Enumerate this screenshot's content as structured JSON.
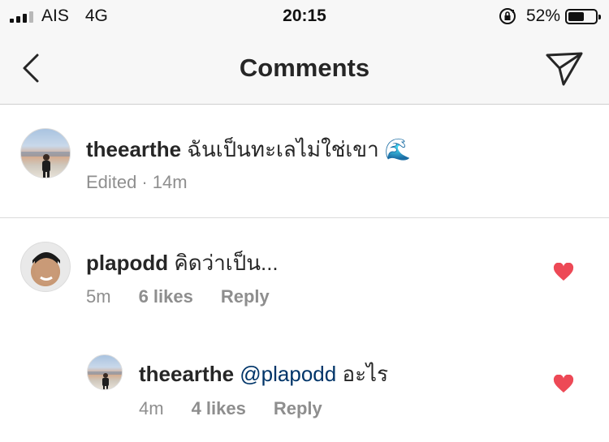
{
  "status_bar": {
    "carrier": "AIS",
    "network": "4G",
    "time": "20:15",
    "battery_percent": "52%",
    "battery_level": 0.52
  },
  "header": {
    "title": "Comments",
    "back_icon": "chevron-left-icon",
    "send_icon": "paper-plane-icon"
  },
  "caption": {
    "username": "theearthe",
    "text": "ฉันเป็นทะเลไม่ใช่เขา 🌊",
    "edited_label": "Edited",
    "separator": "·",
    "time": "14m"
  },
  "comments": [
    {
      "username": "plapodd",
      "text": "คิดว่าเป็น...",
      "time": "5m",
      "likes": "6 likes",
      "reply_label": "Reply",
      "liked": true
    },
    {
      "username": "theearthe",
      "mention": "@plapodd",
      "text": "อะไร",
      "time": "4m",
      "likes": "4 likes",
      "reply_label": "Reply",
      "liked": true
    }
  ],
  "colors": {
    "heart": "#ed4956",
    "mention": "#003569",
    "meta": "#8e8e8e"
  }
}
